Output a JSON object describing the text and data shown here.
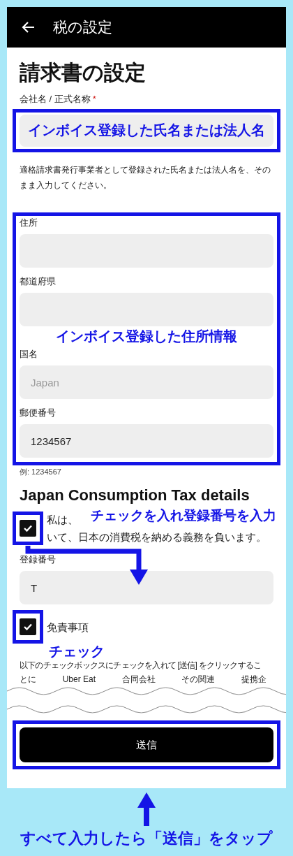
{
  "app_bar": {
    "title": "税の設定"
  },
  "heading": "請求書の設定",
  "company_field": {
    "label": "会社名 / 正式名称",
    "required_mark": "*",
    "annotation": "インボイス登録した氏名または法人名",
    "hint": "適格請求書発行事業者として登録された氏名または法人名を、そのまま入力してください。"
  },
  "address_fields": [
    {
      "label": "住所"
    },
    {
      "label": "都道府県"
    },
    {
      "label": "国名",
      "placeholder": "Japan"
    },
    {
      "label": "郵便番号",
      "value": "1234567"
    }
  ],
  "address_annotation": "インボイス登録した住所情報",
  "postal_hint": "例: 1234567",
  "tax_heading": "Japan Consumption Tax details",
  "tax_checkbox": {
    "checked": true,
    "line_1": "私は、",
    "line_2": "いて、日本の消費税を納める義務を負います。",
    "annotation": "チェックを入れ登録番号を入力"
  },
  "registration_field": {
    "label": "登録番号",
    "value": "T"
  },
  "disclaimer": {
    "checked": true,
    "title": "免責事項",
    "annotation": "チェック",
    "text": "以下のチェックボックスにチェックを入れて [送信] をクリックするこ",
    "fragments": [
      "とに",
      "Uber Eat",
      "合同会社",
      "その関連",
      "提携企"
    ]
  },
  "submit_button": {
    "label": "送信"
  },
  "caption": "すべて入力したら「送信」をタップ"
}
